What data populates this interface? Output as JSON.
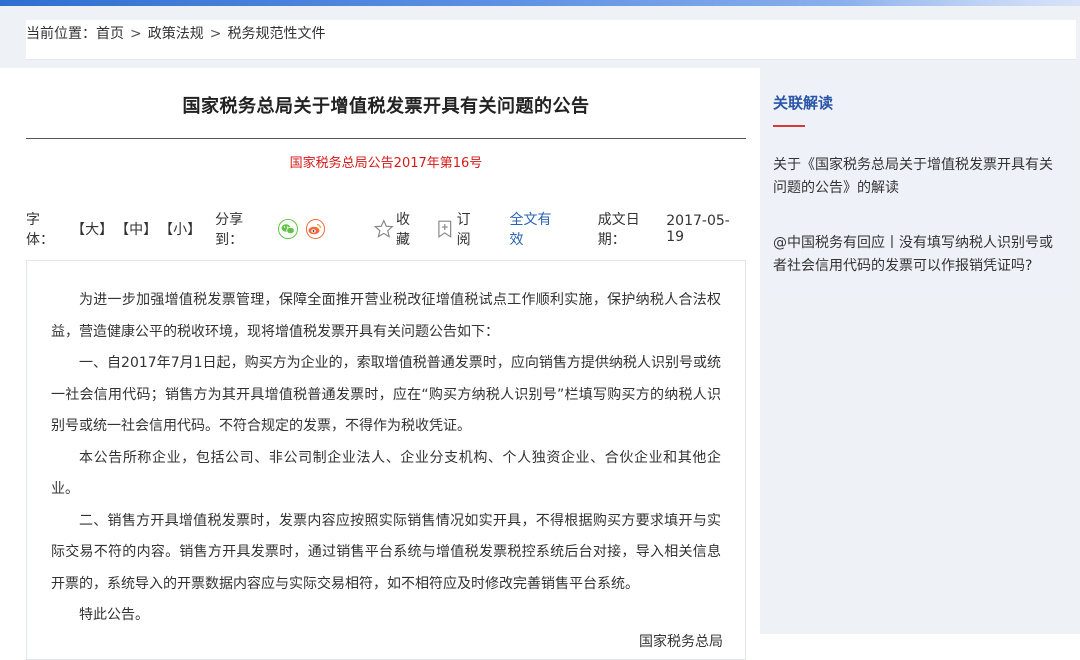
{
  "breadcrumb": {
    "label": "当前位置：",
    "items": [
      "首页",
      "政策法规",
      "税务规范性文件"
    ],
    "separator": ">"
  },
  "article": {
    "title": "国家税务总局关于增值税发票开具有关问题的公告",
    "doc_number": "国家税务总局公告2017年第16号",
    "paragraphs": [
      "为进一步加强增值税发票管理，保障全面推开营业税改征增值税试点工作顺利实施，保护纳税人合法权益，营造健康公平的税收环境，现将增值税发票开具有关问题公告如下：",
      "一、自2017年7月1日起，购买方为企业的，索取增值税普通发票时，应向销售方提供纳税人识别号或统一社会信用代码；销售方为其开具增值税普通发票时，应在“购买方纳税人识别号”栏填写购买方的纳税人识别号或统一社会信用代码。不符合规定的发票，不得作为税收凭证。",
      "本公告所称企业，包括公司、非公司制企业法人、企业分支机构、个人独资企业、合伙企业和其他企业。",
      "二、销售方开具增值税发票时，发票内容应按照实际销售情况如实开具，不得根据购买方要求填开与实际交易不符的内容。销售方开具发票时，通过销售平台系统与增值税发票税控系统后台对接，导入相关信息开票的，系统导入的开票数据内容应与实际交易相符，如不相符应及时修改完善销售平台系统。",
      "特此公告。"
    ],
    "signature": "国家税务总局"
  },
  "toolbar": {
    "font_label": "字体：",
    "font_large": "【大】",
    "font_medium": "【中】",
    "font_small": "【小】",
    "share_label": "分享到：",
    "favorite_label": "收藏",
    "subscribe_label": "订阅",
    "validity": "全文有效",
    "date_label": "成文日期：",
    "date": "2017-05-19"
  },
  "sidebar": {
    "title": "关联解读",
    "items": [
      "关于《国家税务总局关于增值税发票开具有关问题的公告》的解读",
      "@中国税务有回应丨没有填写纳税人识别号或者社会信用代码的发票可以作报销凭证吗?"
    ]
  },
  "colors": {
    "accent_red": "#d41a1a",
    "link_blue": "#2a63b5",
    "wechat_green": "#61c247",
    "weibo_orange": "#f26a3d"
  }
}
